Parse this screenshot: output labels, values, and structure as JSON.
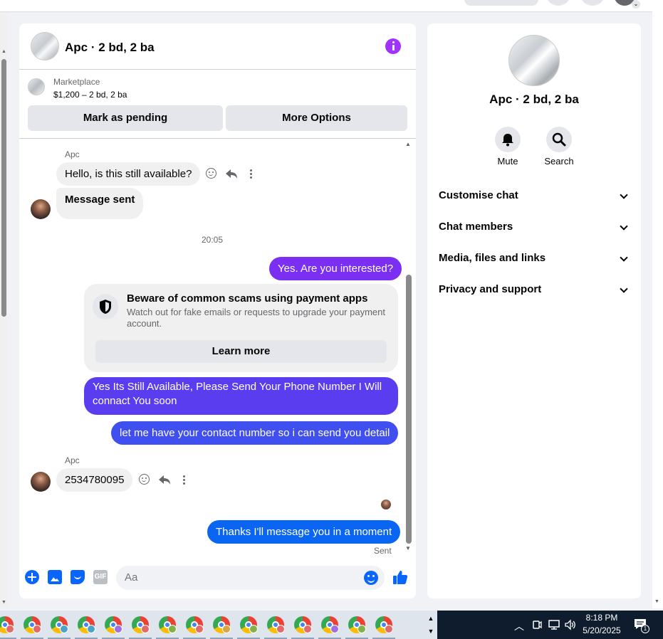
{
  "chat": {
    "title": "Apc · 2 bd, 2 ba",
    "marketplace_label": "Marketplace",
    "listing_price": "$1,200 – 2 bd, 2 ba",
    "mark_pending_label": "Mark as pending",
    "more_options_label": "More Options",
    "messages": [
      {
        "sender": "Apc",
        "text": "Hello, is this still available?"
      },
      {
        "text": "Message sent"
      },
      {
        "timestamp": "20:05"
      },
      {
        "text": "Yes. Are you interested?"
      },
      {
        "text": "Yes Its Still Available, Please Send Your Phone Number I Will connact You soon"
      },
      {
        "text": "let me have your contact number so i can send you detail"
      },
      {
        "sender": "Apc",
        "text": "2534780095"
      },
      {
        "text": "Thanks I'll message you in a moment",
        "status": "Sent"
      }
    ],
    "scam_notice": {
      "title": "Beware of common scams using payment apps",
      "body": "Watch out for fake emails or requests to upgrade your payment account.",
      "button": "Learn more"
    },
    "composer": {
      "placeholder": "Aa",
      "gif_label": "GIF"
    }
  },
  "info_panel": {
    "title": "Apc · 2 bd, 2 ba",
    "mute_label": "Mute",
    "search_label": "Search",
    "sections": [
      "Customise chat",
      "Chat members",
      "Media, files and links",
      "Privacy and support"
    ]
  },
  "taskbar": {
    "time": "8:18 PM",
    "date": "5/20/2025",
    "notification_count": "1",
    "chrome_badge_colors": [
      "#e36a6a",
      "#e36a6a",
      "#4aa3c9",
      "#4aa3c9",
      "#a070e0",
      "#e36a6a",
      "#7fb34a",
      "#e36a6a",
      "#d9a441",
      "#7fb34a",
      "#e36a6a",
      "#e36a6a",
      "#a070e0",
      "#7fb34a",
      "#e36a6a"
    ]
  },
  "colors": {
    "accent_purple": "#a033ff",
    "bubble_violet": "#7b2ff2",
    "bubble_indigo": "#5b3df0",
    "bubble_blue": "#3f4ff0",
    "bubble_messenger_blue": "#0a66f2",
    "messenger_blue": "#0866ff"
  }
}
